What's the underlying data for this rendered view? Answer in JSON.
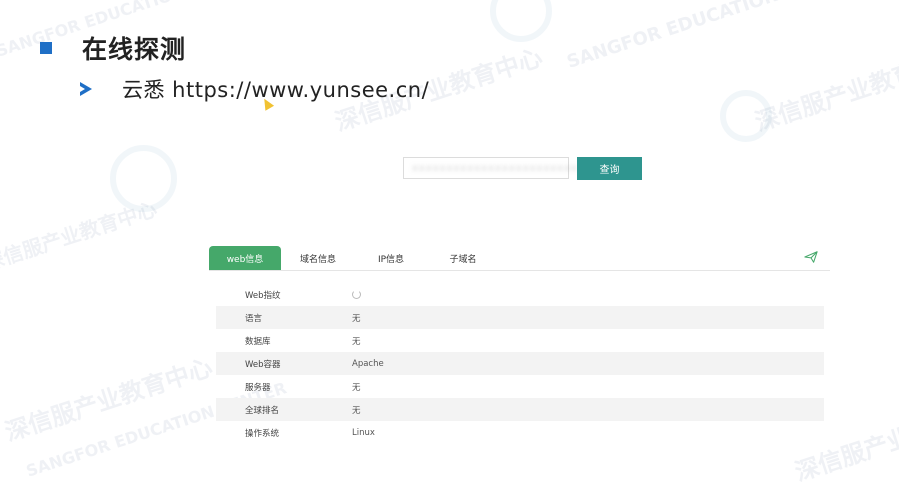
{
  "slide": {
    "title": "在线探测",
    "subtitle": "云悉 https://www.yunsee.cn/"
  },
  "search": {
    "input_value": "xxxxxxxxxxxxxxxxxxxxxxxx",
    "button_label": "查询"
  },
  "tabs": [
    {
      "label": "web信息",
      "active": true
    },
    {
      "label": "域名信息",
      "active": false
    },
    {
      "label": "IP信息",
      "active": false
    },
    {
      "label": "子域名",
      "active": false
    }
  ],
  "info_rows": [
    {
      "label": "Web指纹",
      "value": "",
      "loading": true
    },
    {
      "label": "语言",
      "value": "无"
    },
    {
      "label": "数据库",
      "value": "无"
    },
    {
      "label": "Web容器",
      "value": "Apache"
    },
    {
      "label": "服务器",
      "value": "无"
    },
    {
      "label": "全球排名",
      "value": "无"
    },
    {
      "label": "操作系统",
      "value": "Linux"
    }
  ],
  "watermark": {
    "cn": "深信服产业教育中心",
    "en": "SANGFOR EDUCATION CENTER"
  },
  "icons": {
    "send": "paper-plane-icon"
  },
  "colors": {
    "accent_blue": "#1f6fc6",
    "tab_green": "#45a86a",
    "button_teal": "#2e958f"
  }
}
